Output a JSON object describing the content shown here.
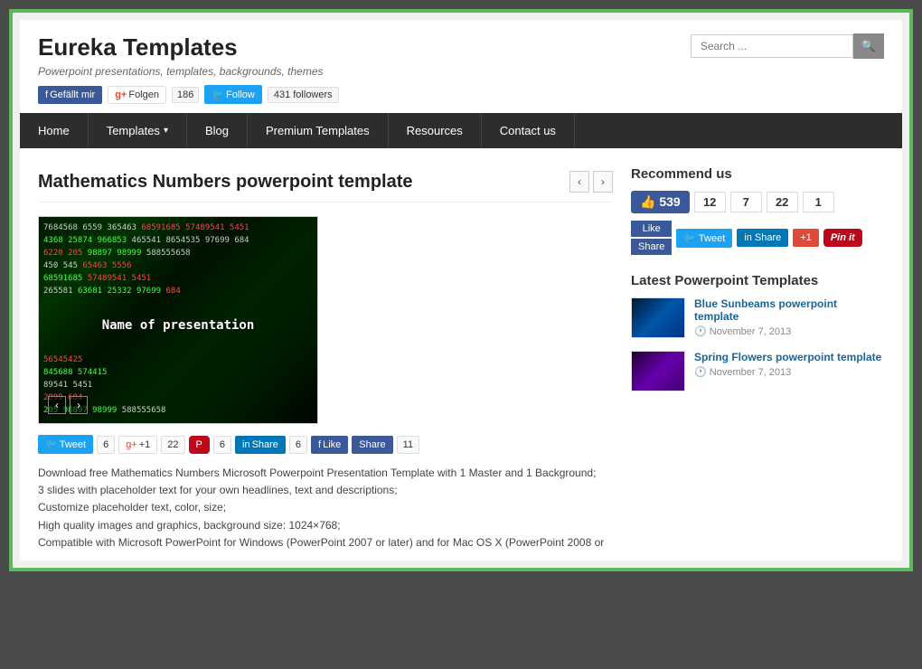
{
  "site": {
    "title": "Eureka Templates",
    "subtitle": "Powerpoint presentations, templates, backgrounds, themes",
    "search_placeholder": "Search ..."
  },
  "social_header": {
    "fb_label": "Gefällt mir",
    "gplus_label": "Folgen",
    "gplus_count": "186",
    "tw_label": "Follow",
    "followers_count": "431 followers"
  },
  "nav": {
    "items": [
      {
        "label": "Home",
        "has_arrow": false
      },
      {
        "label": "Templates",
        "has_arrow": true
      },
      {
        "label": "Blog",
        "has_arrow": false
      },
      {
        "label": "Premium Templates",
        "has_arrow": false
      },
      {
        "label": "Resources",
        "has_arrow": false
      },
      {
        "label": "Contact us",
        "has_arrow": false
      }
    ]
  },
  "article": {
    "title": "Mathematics Numbers powerpoint template",
    "slide_overlay_text": "Name of presentation",
    "share_counts": {
      "tweet": "6",
      "gplus": "22",
      "pin": "6",
      "linkedin": "6",
      "like": "11"
    },
    "description_lines": [
      "Download free Mathematics Numbers Microsoft Powerpoint Presentation Template with 1 Master and 1 Background;",
      "3 slides with placeholder text for your own headlines, text and descriptions;",
      "Customize placeholder text, color, size;",
      "High quality images and graphics, background size: 1024×768;",
      "Compatible with Microsoft PowerPoint for Windows (PowerPoint 2007 or later) and for Mac OS X (PowerPoint 2008 or"
    ]
  },
  "sidebar": {
    "recommend_title": "Recommend us",
    "like_count": "539",
    "like_label": "Like",
    "share_label": "Share",
    "tw_count": "12",
    "tw_label": "Tweet",
    "li_count": "7",
    "li_label": "Share",
    "gp_count": "22",
    "gp_label": "+1",
    "pin_count": "1",
    "pin_label": "Pin it",
    "latest_title": "Latest Powerpoint Templates",
    "latest_items": [
      {
        "title": "Blue Sunbeams powerpoint template",
        "date": "November 7, 2013",
        "thumb_class": "thumb-blue"
      },
      {
        "title": "Spring Flowers powerpoint template",
        "date": "November 7, 2013",
        "thumb_class": "thumb-purple"
      }
    ]
  }
}
